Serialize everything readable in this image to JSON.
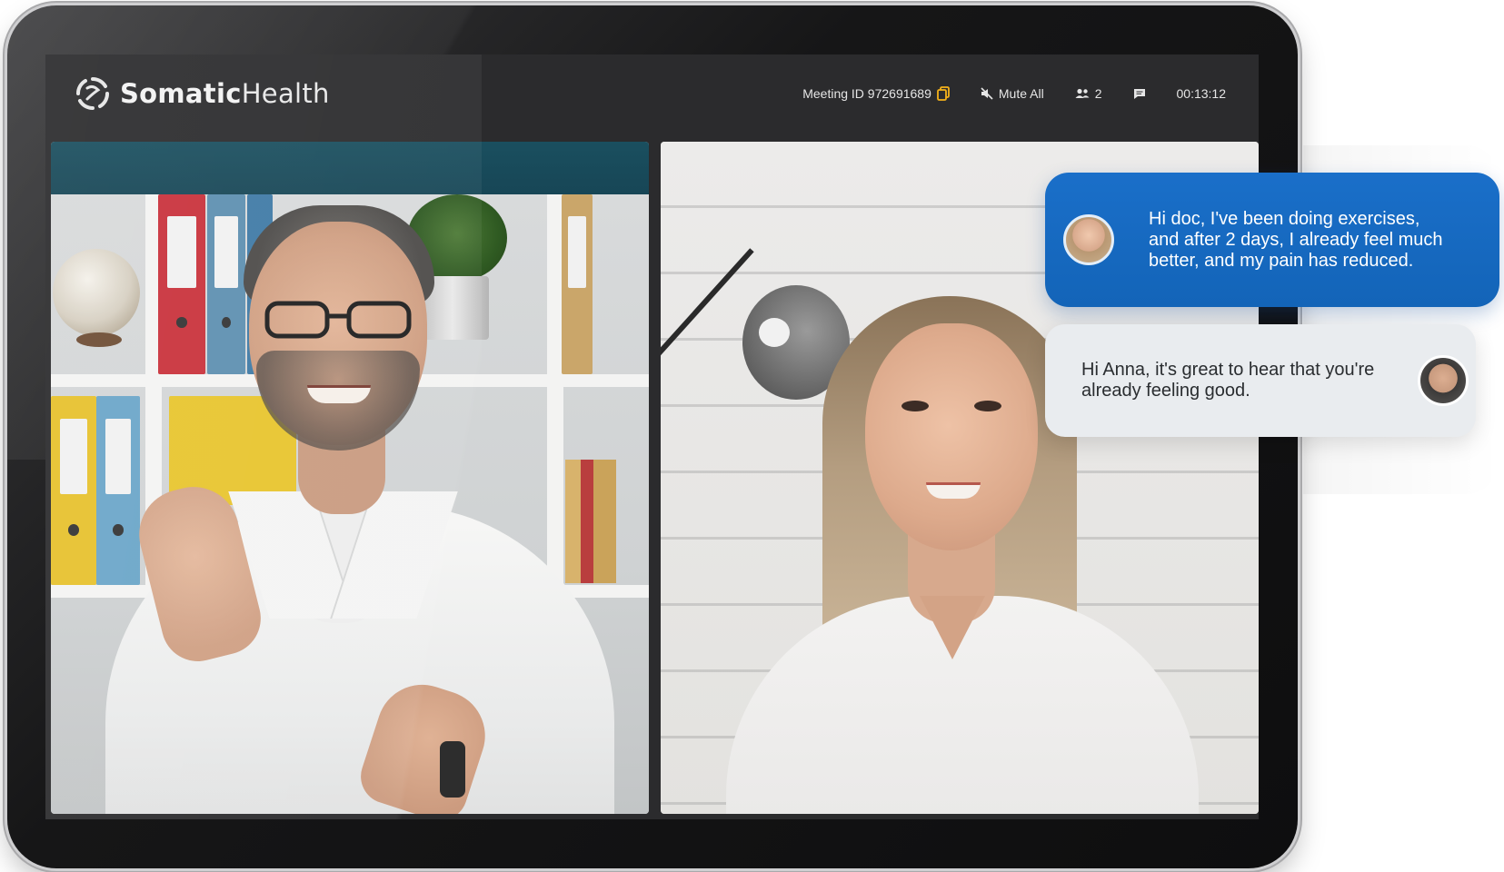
{
  "app": {
    "brand_bold": "Somatic",
    "brand_light": "Health"
  },
  "toolbar": {
    "meeting_id_label": "Meeting ID 972691689",
    "mute_all_label": "Mute All",
    "participants_count": "2",
    "timer": "00:13:12"
  },
  "icons": {
    "logo": "somatichealth-logo-icon",
    "copy": "copy-icon",
    "mute": "speaker-muted-icon",
    "participants": "people-icon",
    "chat": "chat-icon"
  },
  "colors": {
    "accent_copy": "#f5b21a",
    "chat_incoming": "#1a6fc9",
    "chat_outgoing": "#e9ecef",
    "teal_band": "#1a4f5f"
  },
  "chat": {
    "messages": [
      {
        "sender": "patient",
        "text": "Hi doc, I've been doing exercises, and after 2 days, I already feel much better, and my pain has reduced."
      },
      {
        "sender": "doctor",
        "text": "Hi Anna, it's great to hear that you're already feeling good."
      }
    ]
  }
}
